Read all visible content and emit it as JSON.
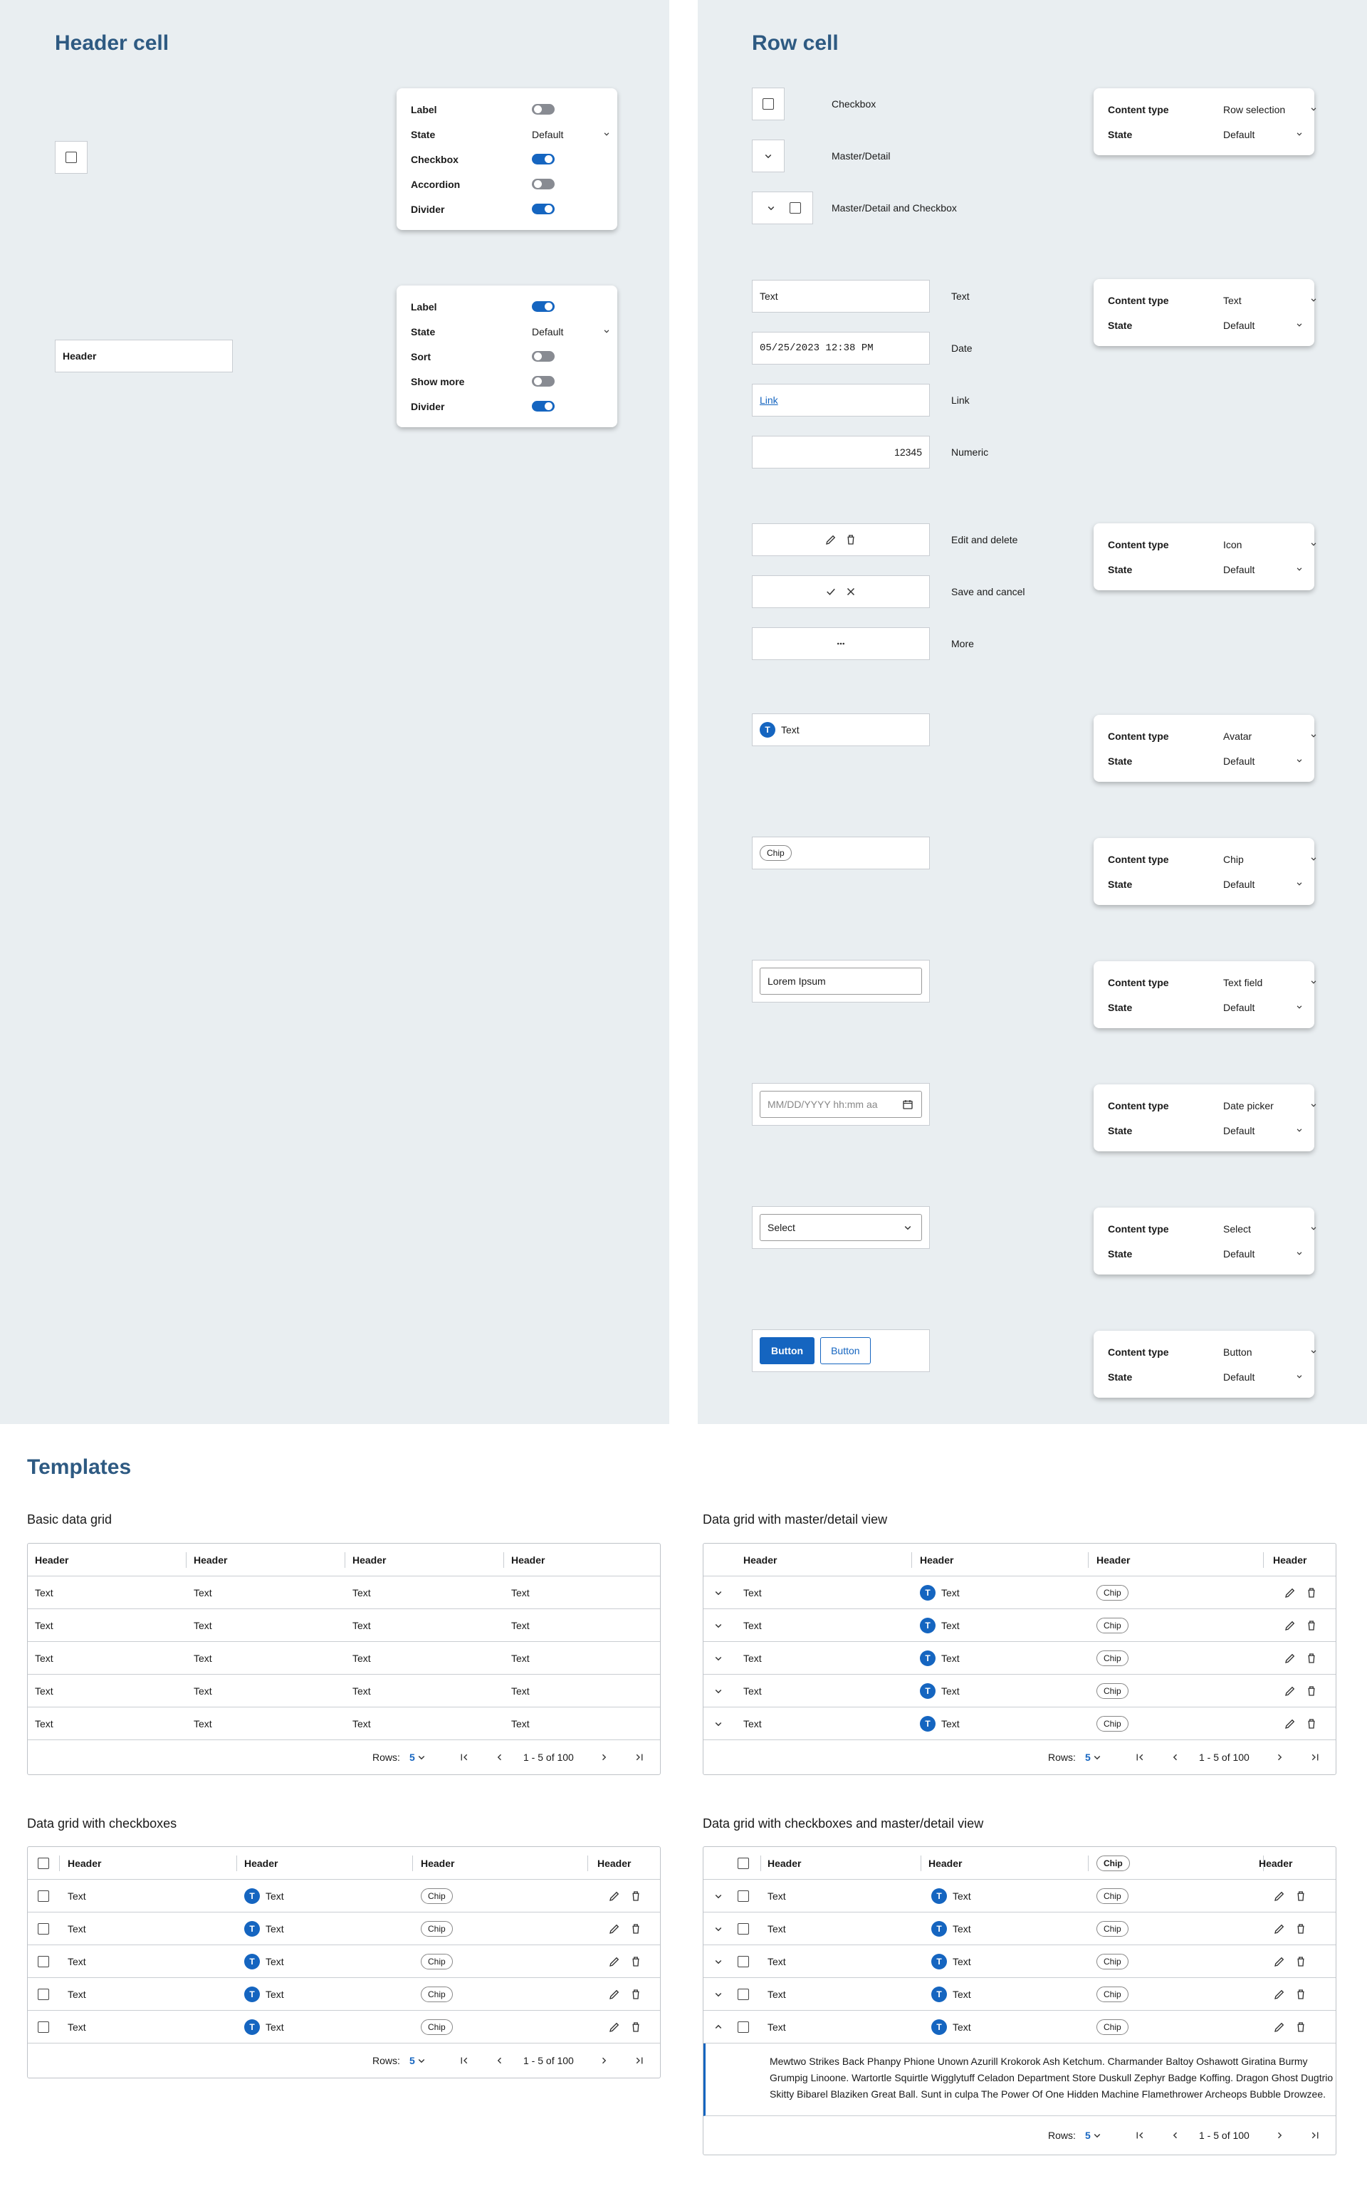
{
  "header_cell": {
    "title": "Header cell",
    "card1": [
      {
        "k": "Label",
        "t": "off"
      },
      {
        "k": "State",
        "v": "Default"
      },
      {
        "k": "Checkbox",
        "t": "on"
      },
      {
        "k": "Accordion",
        "t": "off"
      },
      {
        "k": "Divider",
        "t": "on"
      }
    ],
    "card2": [
      {
        "k": "Label",
        "t": "on"
      },
      {
        "k": "State",
        "v": "Default"
      },
      {
        "k": "Sort",
        "t": "off"
      },
      {
        "k": "Show more",
        "t": "off"
      },
      {
        "k": "Divider",
        "t": "on"
      }
    ],
    "header_label": "Header"
  },
  "row_cell": {
    "title": "Row cell",
    "labels": {
      "checkbox": "Checkbox",
      "master": "Master/Detail",
      "master_cb": "Master/Detail and Checkbox",
      "text": "Text",
      "date": "Date",
      "link": "Link",
      "numeric": "Numeric",
      "edit": "Edit and delete",
      "save": "Save and cancel",
      "more": "More"
    },
    "values": {
      "text": "Text",
      "date": "05/25/2023 12:38 PM",
      "link": "Link",
      "numeric": "12345",
      "avatar_letter": "T",
      "avatar_text": "Text",
      "chip": "Chip",
      "textfield": "Lorem Ipsum",
      "datepicker": "MM/DD/YYYY hh:mm aa",
      "select": "Select",
      "button1": "Button",
      "button2": "Button"
    },
    "cards": [
      {
        "ct": "Row selection",
        "st": "Default"
      },
      {
        "ct": "Text",
        "st": "Default"
      },
      {
        "ct": "Icon",
        "st": "Default"
      },
      {
        "ct": "Avatar",
        "st": "Default"
      },
      {
        "ct": "Chip",
        "st": "Default"
      },
      {
        "ct": "Text field",
        "st": "Default"
      },
      {
        "ct": "Date picker",
        "st": "Default"
      },
      {
        "ct": "Select",
        "st": "Default"
      },
      {
        "ct": "Button",
        "st": "Default"
      }
    ],
    "card_keys": {
      "content_type": "Content type",
      "state": "State"
    }
  },
  "templates": {
    "title": "Templates",
    "basic": {
      "title": "Basic data grid"
    },
    "master": {
      "title": "Data grid with master/detail view"
    },
    "checkboxes": {
      "title": "Data grid with checkboxes"
    },
    "cbmaster": {
      "title": "Data grid with checkboxes and master/detail view"
    },
    "header": "Header",
    "text": "Text",
    "chip": "Chip",
    "avatar_letter": "T",
    "rows_label": "Rows:",
    "rows_value": "5",
    "range": "1 - 5 of 100",
    "detail_text": "Mewtwo Strikes Back Phanpy Phione Unown Azurill Krokorok Ash Ketchum. Charmander Baltoy Oshawott Giratina Burmy Grumpig Linoone. Wartortle Squirtle Wigglytuff Celadon Department Store Duskull Zephyr Badge Koffing. Dragon Ghost Dugtrio Skitty Bibarel Blaziken Great Ball. Sunt in culpa The Power Of One Hidden Machine Flamethrower Archeops Bubble Drowzee."
  },
  "colors": {
    "accent": "#1565c0",
    "title": "#2e5a82",
    "panel": "#e9eef1"
  }
}
